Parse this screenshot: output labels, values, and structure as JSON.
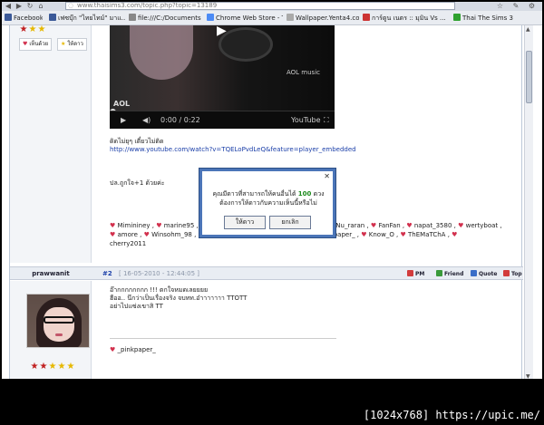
{
  "browser": {
    "url": "www.thaisims3.com/topic.php?topic=13189",
    "bookmarks": [
      {
        "label": "Facebook",
        "color": "#3b5998"
      },
      {
        "label": "เฟซบุ๊ก \"ไทยไทม์\" มาแ...",
        "color": "#3b5998"
      },
      {
        "label": "file:///C:/Documents ...",
        "color": "#888888"
      },
      {
        "label": "Chrome Web Store - T...",
        "color": "#4c8bf5"
      },
      {
        "label": "Wallpaper.Yenta4.co...",
        "color": "#aaaaaa"
      },
      {
        "label": "การ์ตูน เนตร :: มุมิน Vs ...",
        "color": "#cc3333"
      },
      {
        "label": "Thai The Sims 3",
        "color": "#2fa12f"
      }
    ]
  },
  "post1": {
    "buttons": {
      "agree": "เห็นด้วย",
      "thanks": "ให้ดาว"
    },
    "video": {
      "time": "0:00 / 0:22",
      "brand": "AOL",
      "brand_music": "AOL music",
      "youtube": "YouTube"
    },
    "text_line1": "ดิดไม่ยุๆ เดี๋ยวไม่ติด",
    "link": "http://www.youtube.com/watch?v=TQELoPvdLeQ&feature=player_embedded",
    "text_line2": "ปล.ถูกใจ+1 ด้วยค่ะ",
    "thanks_names": [
      "Mimininey",
      "marine95",
      "",
      "Nu_raran",
      "FanFan",
      "napat_3580",
      "wertyboat",
      "amore",
      "Winsohm_98",
      "",
      "_pinkpaper_",
      "Know_O",
      "ThEMaTChA",
      "cherry2011"
    ]
  },
  "post2": {
    "author": "prawwanit",
    "number": "#2",
    "date": "[ 16-05-2010 - 12:44:05 ]",
    "tools": {
      "pm": "PM",
      "friend": "Friend",
      "quote": "Quote",
      "top": "Top"
    },
    "line1": "อ๊ากกกกกกกก !!! ตกใจหมดเลยยยย",
    "line2": "ฮืออ.. นึกว่าเป็นเรื่องจริง จบทท.อ๋าาาาาาา TTOTT",
    "line3": "อย่าไปแซ่งเขาสิ TT",
    "signature": "_pinkpaper_"
  },
  "dialog": {
    "line1_prefix": "คุณมีดาวที่สามารถให้คนอื่นได้",
    "stars": "100",
    "line1_suffix": "ดวง",
    "line2": "ต้องการให้ดาวกับความเห็นนี้หรือไม่",
    "ok": "ให้ดาว",
    "cancel": "ยกเลิก"
  },
  "watermark": "[1024x768] https://upic.me/",
  "colors": {
    "accent": "#4b75b8",
    "link": "#1a3ea8",
    "heart": "#d2304d"
  }
}
